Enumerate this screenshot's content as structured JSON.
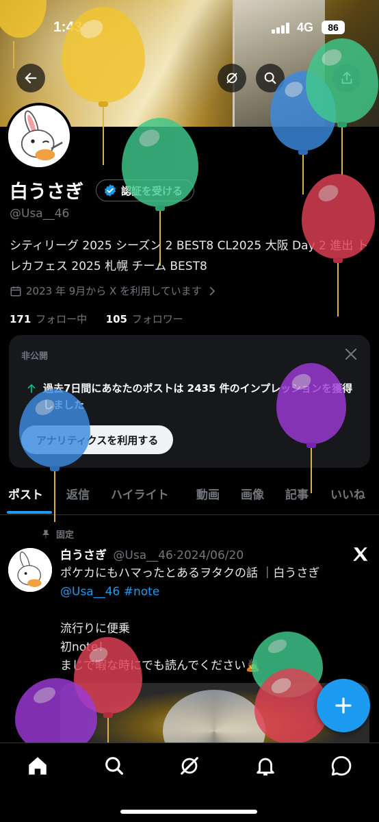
{
  "status_bar": {
    "time": "1:43",
    "network": "4G",
    "battery": "86"
  },
  "profile": {
    "name": "白うさぎ",
    "verify_label": "認証を受ける",
    "handle": "@Usa__46",
    "bio": "シティリーグ 2025 シーズン 2 BEST8 CL2025 大阪 Day 2 進出 トレカフェス 2025 札幌 チーム BEST8",
    "joined": "2023 年 9月から X を利用しています",
    "following_count": "171",
    "following_label": "フォロー中",
    "followers_count": "105",
    "followers_label": "フォロワー"
  },
  "analytics_card": {
    "private_label": "非公開",
    "message": "過去7日間にあなたのポストは 2435 件のインプレッションを獲得しました",
    "cta_label": "アナリティクスを利用する"
  },
  "tabs": [
    {
      "label": "ポスト",
      "active": true
    },
    {
      "label": "返信",
      "active": false
    },
    {
      "label": "ハイライト",
      "active": false
    },
    {
      "label": "動画",
      "active": false
    },
    {
      "label": "画像",
      "active": false
    },
    {
      "label": "記事",
      "active": false
    },
    {
      "label": "いいね",
      "active": false
    }
  ],
  "pinned_post": {
    "pinned_label": "固定",
    "author_name": "白うさぎ",
    "author_handle": "@Usa__46",
    "date": "2024/06/20",
    "line1": "ポケカにもハマったとあるヲタクの話 ｜白うさぎ",
    "link": "@Usa__46 #note",
    "line2": "流行りに便乗",
    "line3": "初note！",
    "line4": "まじで暇な時にでも読んでください🙇"
  },
  "colors": {
    "accent": "#1d9bf0",
    "background": "#000000",
    "card": "#16181c",
    "muted_text": "#71767b"
  },
  "icons": {
    "back": "arrow-left-icon",
    "grok": "grok-icon",
    "search": "search-icon",
    "share": "share-icon",
    "compose": "plus-icon",
    "nav": [
      "home-icon",
      "search-icon",
      "grok-icon",
      "bell-icon",
      "message-icon"
    ]
  }
}
